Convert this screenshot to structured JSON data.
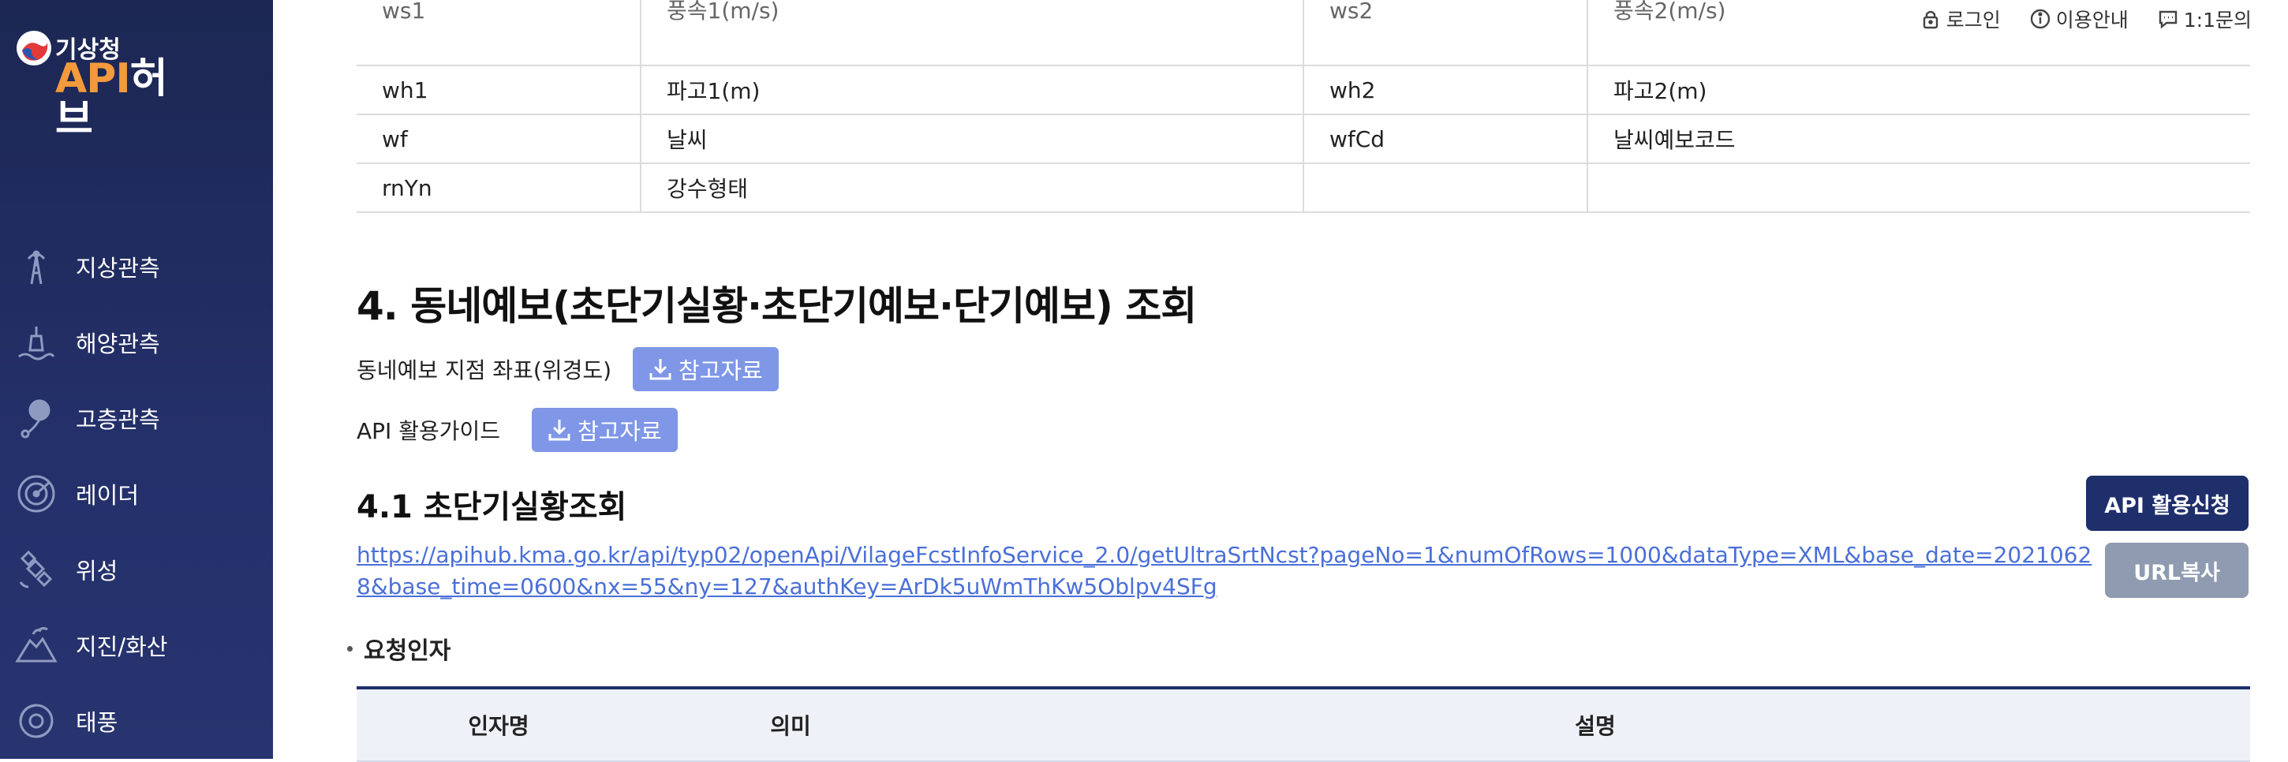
{
  "brand": {
    "sub": "기상청",
    "api": "API",
    "hub": "허브"
  },
  "utility": {
    "login": "로그인",
    "guide": "이용안내",
    "inquiry": "1:1문의"
  },
  "sidebar": {
    "items": [
      {
        "label": "지상관측",
        "icon": "tower-icon"
      },
      {
        "label": "해양관측",
        "icon": "buoy-icon"
      },
      {
        "label": "고층관측",
        "icon": "balloon-icon"
      },
      {
        "label": "레이더",
        "icon": "radar-icon"
      },
      {
        "label": "위성",
        "icon": "satellite-icon"
      },
      {
        "label": "지진/화산",
        "icon": "volcano-icon"
      },
      {
        "label": "태풍",
        "icon": "typhoon-icon"
      }
    ]
  },
  "param_table": {
    "rows": [
      [
        "ws1",
        "풍속1(m/s)",
        "ws2",
        "풍속2(m/s)"
      ],
      [
        "wh1",
        "파고1(m)",
        "wh2",
        "파고2(m)"
      ],
      [
        "wf",
        "날씨",
        "wfCd",
        "날씨예보코드"
      ],
      [
        "rnYn",
        "강수형태",
        "",
        ""
      ]
    ]
  },
  "section": {
    "title": "4. 동네예보(초단기실황·초단기예보·단기예보) 조회",
    "ref1_label": "동네예보 지점 좌표(위경도)",
    "ref1_button": "참고자료",
    "ref2_label": "API 활용가이드",
    "ref2_button": "참고자료"
  },
  "subsection": {
    "title": "4.1 초단기실황조회",
    "apply_button": "API 활용신청",
    "copy_button": "URL복사",
    "url": "https://apihub.kma.go.kr/api/typ02/openApi/VilageFcstInfoService_2.0/getUltraSrtNcst?pageNo=1&numOfRows=1000&dataType=XML&base_date=20210628&base_time=0600&nx=55&ny=127&authKey=ArDk5uWmThKw5Oblpv4SFg",
    "request_title": "요청인자",
    "columns": [
      "인자명",
      "의미",
      "설명"
    ]
  },
  "colors": {
    "sidebar_bg": "#1c2753",
    "brand_orange": "#f39a3c",
    "ref_button": "#7f97e6",
    "apply_button": "#1f2f6b",
    "copy_button": "#8f9bb1",
    "link": "#4a6fd8"
  }
}
